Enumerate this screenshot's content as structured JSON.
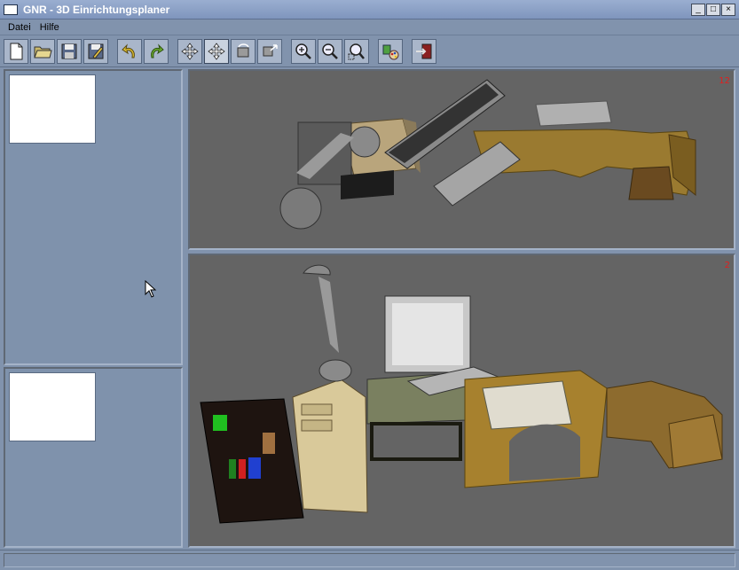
{
  "window": {
    "title": "GNR - 3D Einrichtungsplaner",
    "controls": [
      "_",
      "□",
      "×"
    ]
  },
  "menu": {
    "items": [
      "Datei",
      "Hilfe"
    ]
  },
  "toolbar": {
    "buttons": [
      {
        "name": "new-file",
        "icon": "new-document-icon"
      },
      {
        "name": "open-file",
        "icon": "open-folder-icon"
      },
      {
        "name": "save-file",
        "icon": "save-disk-icon"
      },
      {
        "name": "edit-file",
        "icon": "edit-document-icon"
      },
      {
        "name": "undo",
        "icon": "undo-icon"
      },
      {
        "name": "redo",
        "icon": "redo-icon"
      },
      {
        "name": "move",
        "icon": "move-arrows-icon"
      },
      {
        "name": "move-active",
        "icon": "move-arrows-active-icon"
      },
      {
        "name": "rotate",
        "icon": "rotate-icon"
      },
      {
        "name": "scale",
        "icon": "scale-icon"
      },
      {
        "name": "zoom-in",
        "icon": "zoom-in-icon"
      },
      {
        "name": "zoom-out",
        "icon": "zoom-out-icon"
      },
      {
        "name": "zoom-fit",
        "icon": "zoom-fit-icon"
      },
      {
        "name": "materials",
        "icon": "palette-icon"
      },
      {
        "name": "exit",
        "icon": "exit-door-icon"
      }
    ]
  },
  "viewports": {
    "top": {
      "label": "12"
    },
    "bottom": {
      "label": "2"
    }
  },
  "colors": {
    "background": "#8193ad",
    "viewport_bg": "#646464",
    "viewport_label": "#e02020"
  }
}
